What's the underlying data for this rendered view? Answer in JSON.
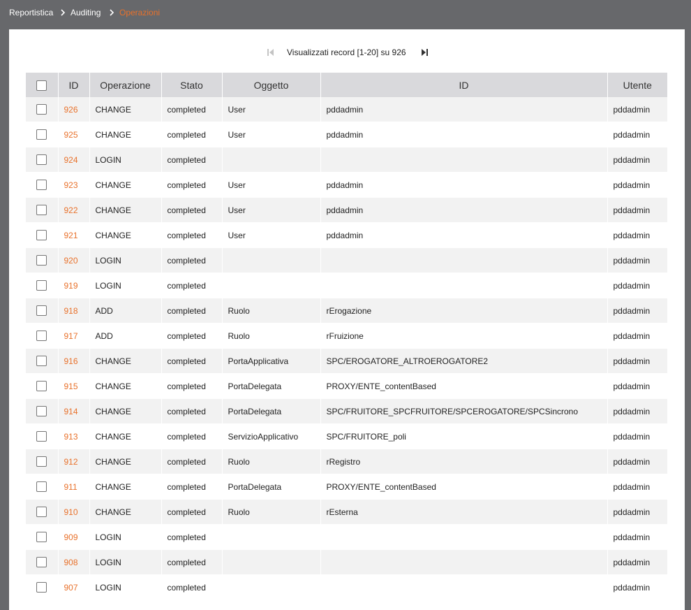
{
  "breadcrumb": {
    "items": [
      "Reportistica",
      "Auditing"
    ],
    "current": "Operazioni"
  },
  "pager": {
    "text": "Visualizzati record [1-20] su 926"
  },
  "table": {
    "columns": [
      "ID",
      "Operazione",
      "Stato",
      "Oggetto",
      "ID",
      "Utente"
    ],
    "rows": [
      {
        "id": "926",
        "operazione": "CHANGE",
        "stato": "completed",
        "oggetto": "User",
        "oggetto_id": "pddadmin",
        "utente": "pddadmin"
      },
      {
        "id": "925",
        "operazione": "CHANGE",
        "stato": "completed",
        "oggetto": "User",
        "oggetto_id": "pddadmin",
        "utente": "pddadmin"
      },
      {
        "id": "924",
        "operazione": "LOGIN",
        "stato": "completed",
        "oggetto": "",
        "oggetto_id": "",
        "utente": "pddadmin"
      },
      {
        "id": "923",
        "operazione": "CHANGE",
        "stato": "completed",
        "oggetto": "User",
        "oggetto_id": "pddadmin",
        "utente": "pddadmin"
      },
      {
        "id": "922",
        "operazione": "CHANGE",
        "stato": "completed",
        "oggetto": "User",
        "oggetto_id": "pddadmin",
        "utente": "pddadmin"
      },
      {
        "id": "921",
        "operazione": "CHANGE",
        "stato": "completed",
        "oggetto": "User",
        "oggetto_id": "pddadmin",
        "utente": "pddadmin"
      },
      {
        "id": "920",
        "operazione": "LOGIN",
        "stato": "completed",
        "oggetto": "",
        "oggetto_id": "",
        "utente": "pddadmin"
      },
      {
        "id": "919",
        "operazione": "LOGIN",
        "stato": "completed",
        "oggetto": "",
        "oggetto_id": "",
        "utente": "pddadmin"
      },
      {
        "id": "918",
        "operazione": "ADD",
        "stato": "completed",
        "oggetto": "Ruolo",
        "oggetto_id": "rErogazione",
        "utente": "pddadmin"
      },
      {
        "id": "917",
        "operazione": "ADD",
        "stato": "completed",
        "oggetto": "Ruolo",
        "oggetto_id": "rFruizione",
        "utente": "pddadmin"
      },
      {
        "id": "916",
        "operazione": "CHANGE",
        "stato": "completed",
        "oggetto": "PortaApplicativa",
        "oggetto_id": "SPC/EROGATORE_ALTROEROGATORE2",
        "utente": "pddadmin"
      },
      {
        "id": "915",
        "operazione": "CHANGE",
        "stato": "completed",
        "oggetto": "PortaDelegata",
        "oggetto_id": "PROXY/ENTE_contentBased",
        "utente": "pddadmin"
      },
      {
        "id": "914",
        "operazione": "CHANGE",
        "stato": "completed",
        "oggetto": "PortaDelegata",
        "oggetto_id": "SPC/FRUITORE_SPCFRUITORE/SPCEROGATORE/SPCSincrono",
        "utente": "pddadmin"
      },
      {
        "id": "913",
        "operazione": "CHANGE",
        "stato": "completed",
        "oggetto": "ServizioApplicativo",
        "oggetto_id": "SPC/FRUITORE_poli",
        "utente": "pddadmin"
      },
      {
        "id": "912",
        "operazione": "CHANGE",
        "stato": "completed",
        "oggetto": "Ruolo",
        "oggetto_id": "rRegistro",
        "utente": "pddadmin"
      },
      {
        "id": "911",
        "operazione": "CHANGE",
        "stato": "completed",
        "oggetto": "PortaDelegata",
        "oggetto_id": "PROXY/ENTE_contentBased",
        "utente": "pddadmin"
      },
      {
        "id": "910",
        "operazione": "CHANGE",
        "stato": "completed",
        "oggetto": "Ruolo",
        "oggetto_id": "rEsterna",
        "utente": "pddadmin"
      },
      {
        "id": "909",
        "operazione": "LOGIN",
        "stato": "completed",
        "oggetto": "",
        "oggetto_id": "",
        "utente": "pddadmin"
      },
      {
        "id": "908",
        "operazione": "LOGIN",
        "stato": "completed",
        "oggetto": "",
        "oggetto_id": "",
        "utente": "pddadmin"
      },
      {
        "id": "907",
        "operazione": "LOGIN",
        "stato": "completed",
        "oggetto": "",
        "oggetto_id": "",
        "utente": "pddadmin"
      }
    ]
  },
  "colors": {
    "topbar": "#67686b",
    "accent": "#e8712b",
    "header_bg": "#d9d9dc",
    "row_alt": "#f2f2f2"
  },
  "icons": {
    "breadcrumb_separator": "chevron-right-icon",
    "pager_first": "first-page-icon",
    "pager_last": "last-page-icon"
  }
}
